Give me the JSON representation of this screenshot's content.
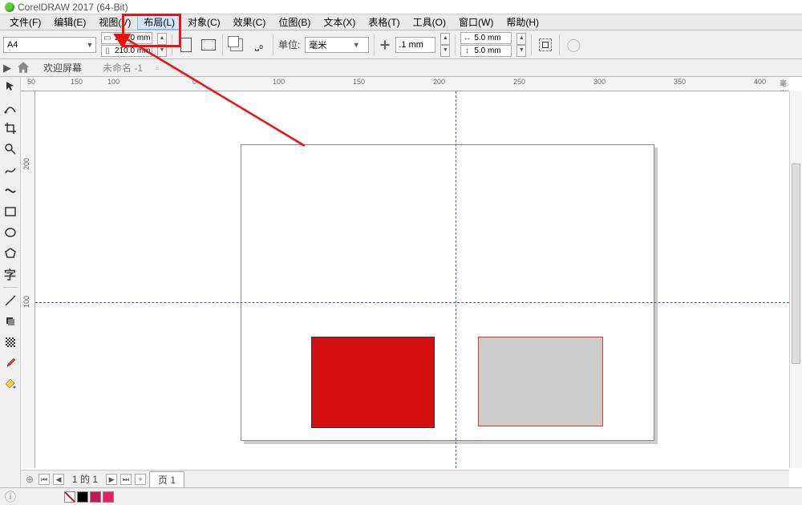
{
  "title": "CorelDRAW 2017 (64-Bit)",
  "menu": [
    "文件(F)",
    "编辑(E)",
    "视图(V)",
    "布局(L)",
    "对象(C)",
    "效果(C)",
    "位图(B)",
    "文本(X)",
    "表格(T)",
    "工具(O)",
    "窗口(W)",
    "帮助(H)"
  ],
  "menu_highlight_index": 3,
  "toolbar": {
    "paper_size": "A4",
    "page_w": "297.0 mm",
    "page_h": "210.0 mm",
    "unit_label": "单位:",
    "unit_value": "毫米",
    "nudge": ".1 mm",
    "dup_x": "5.0 mm",
    "dup_y": "5.0 mm"
  },
  "tabs": {
    "welcome": "欢迎屏幕",
    "doc": "未命名 -1"
  },
  "ruler": {
    "h": [
      "0",
      "50",
      "100",
      "150",
      "200",
      "250",
      "300",
      "350",
      "400"
    ],
    "h_unit": "毫米",
    "v": [
      "200",
      "100"
    ]
  },
  "pagenav": {
    "label": "1  的  1",
    "tab": "页 1"
  },
  "swatches": [
    "#000000",
    "#c2185b",
    "#e91e63"
  ]
}
